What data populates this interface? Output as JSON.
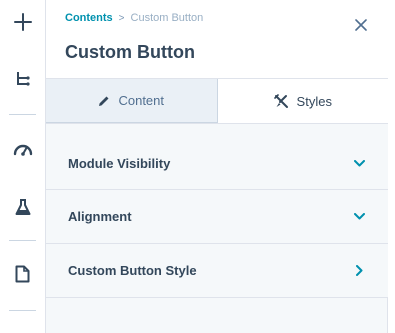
{
  "toolbar": {
    "items": [
      {
        "icon": "plus-icon"
      },
      {
        "icon": "tree-structure-icon"
      },
      {
        "icon": "speedometer-icon"
      },
      {
        "icon": "flask-icon"
      },
      {
        "icon": "document-icon"
      }
    ]
  },
  "header": {
    "breadcrumb_root": "Contents",
    "breadcrumb_separator": ">",
    "breadcrumb_current": "Custom Button",
    "title": "Custom Button",
    "close_icon": "close-icon"
  },
  "tabs": [
    {
      "label": "Content",
      "icon": "pencil-icon",
      "active": false
    },
    {
      "label": "Styles",
      "icon": "brush-tools-icon",
      "active": true
    }
  ],
  "sections": [
    {
      "label": "Module Visibility",
      "chevron": "chevron-down-icon"
    },
    {
      "label": "Alignment",
      "chevron": "chevron-down-icon"
    },
    {
      "label": "Custom Button Style",
      "chevron": "chevron-right-icon"
    }
  ],
  "colors": {
    "accent": "#0091ae",
    "text": "#33475b",
    "panel_bg": "#f5f8fa",
    "border": "#dfe3eb"
  }
}
